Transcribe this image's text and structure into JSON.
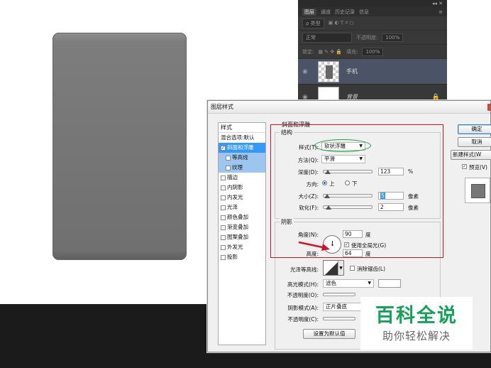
{
  "layers_panel": {
    "window_controls": "◂◂ ✕",
    "tabs": [
      "图层",
      "通道",
      "历史记录",
      "信息"
    ],
    "filter_kind": "ρ 类型",
    "blend_mode": "正常",
    "opacity_label": "不透明度:",
    "opacity_value": "100%",
    "lock_label": "锁定:",
    "fill_label": "填充:",
    "fill_value": "100%",
    "layers": [
      {
        "name": "手机"
      },
      {
        "name": "背景"
      }
    ]
  },
  "dialog": {
    "title": "图层样式",
    "styles_header": "样式",
    "blend_defaults": "混合选项:默认",
    "styles": [
      {
        "label": "斜面和浮雕",
        "checked": true
      },
      {
        "label": "等高线",
        "checked": false
      },
      {
        "label": "纹理",
        "checked": false
      },
      {
        "label": "描边",
        "checked": false
      },
      {
        "label": "内阴影",
        "checked": false
      },
      {
        "label": "内发光",
        "checked": false
      },
      {
        "label": "光泽",
        "checked": false
      },
      {
        "label": "颜色叠加",
        "checked": false
      },
      {
        "label": "渐变叠加",
        "checked": false
      },
      {
        "label": "图案叠加",
        "checked": false
      },
      {
        "label": "外发光",
        "checked": false
      },
      {
        "label": "投影",
        "checked": false
      }
    ],
    "section_title": "斜面和浮雕",
    "structure": {
      "title": "结构",
      "style_label": "样式(T):",
      "style_value": "软状浮雕",
      "technique_label": "方法(Q):",
      "technique_value": "平滑",
      "depth_label": "深度(D):",
      "depth_value": "123",
      "depth_unit": "%",
      "direction_label": "方向:",
      "direction_up": "上",
      "direction_down": "下",
      "size_label": "大小(Z):",
      "size_value": "5",
      "size_unit": "像素",
      "soften_label": "软化(F):",
      "soften_value": "2",
      "soften_unit": "像素"
    },
    "shading": {
      "title": "阴影",
      "angle_label": "角度(N):",
      "angle_value": "90",
      "angle_unit": "度",
      "global_light_label": "使用全局光(G)",
      "global_light_checked": true,
      "altitude_label": "高度:",
      "altitude_value": "64",
      "altitude_unit": "度",
      "gloss_contour_label": "光泽等高线:",
      "anti_alias_label": "消除锯齿(L)",
      "highlight_mode_label": "高光模式(H):",
      "highlight_mode_value": "滤色",
      "highlight_opacity_label": "不透明度(O):",
      "shadow_mode_label": "阴影模式(A):",
      "shadow_mode_value": "正片叠底",
      "shadow_opacity_label": "不透明度(C):"
    },
    "buttons": {
      "ok": "确定",
      "cancel": "取消",
      "new_style": "新建样式(W",
      "preview": "预览(V)",
      "set_default": "设置为默认值"
    }
  },
  "watermark": {
    "line1": "百科全说",
    "line2": "助你轻松解决"
  }
}
